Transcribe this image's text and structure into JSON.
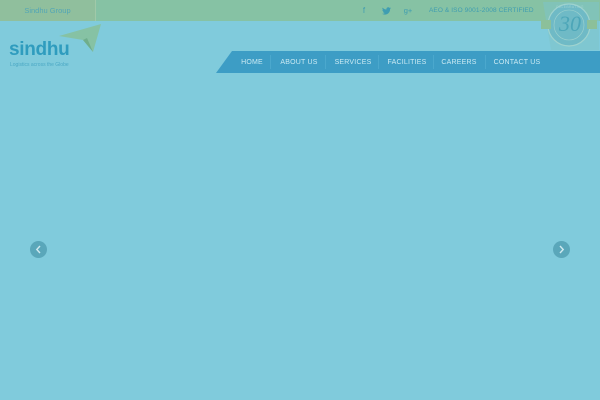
{
  "topbar": {
    "group_label": "Sindhu Group",
    "certification": "AEO & ISO 9001-2008 CERTIFIED",
    "social": [
      {
        "name": "facebook-icon",
        "glyph": "f"
      },
      {
        "name": "twitter-icon",
        "glyph": "🐦"
      },
      {
        "name": "google-plus-icon",
        "glyph": "g+"
      }
    ]
  },
  "seal": {
    "number": "30",
    "ring_text": "CELEBRATING"
  },
  "logo": {
    "wordmark": "sindhu",
    "tagline": "Logistics across the Globe"
  },
  "nav": {
    "items": [
      "HOME",
      "ABOUT US",
      "SERVICES",
      "FACILITIES",
      "CAREERS",
      "CONTACT US"
    ]
  },
  "slider": {
    "prev_icon": "chevron-left-icon",
    "next_icon": "chevron-right-icon"
  },
  "colors": {
    "background": "#80cbdc",
    "topbar": "#86c2a4",
    "nav": "#3d9dc5",
    "brand_text": "#2f9cbe",
    "accent_green": "#8cc09a"
  }
}
